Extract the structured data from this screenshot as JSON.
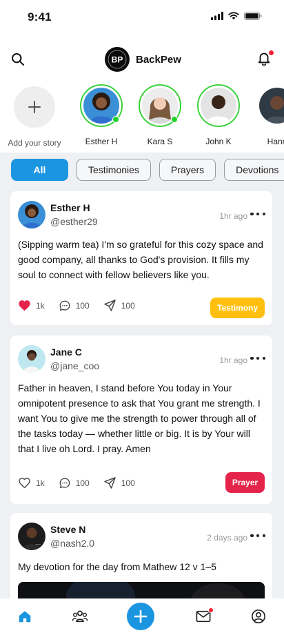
{
  "status_bar": {
    "time": "9:41"
  },
  "header": {
    "app_name": "BackPew",
    "logo_text": "BP"
  },
  "stories": {
    "add_label": "Add your story",
    "items": [
      {
        "name": "Esther H",
        "online": true
      },
      {
        "name": "Kara S",
        "online": true
      },
      {
        "name": "John K",
        "online": false
      },
      {
        "name": "Hann",
        "online": false
      }
    ]
  },
  "filters": {
    "items": [
      "All",
      "Testimonies",
      "Prayers",
      "Devotions"
    ],
    "active": "All"
  },
  "posts": [
    {
      "name": "Esther H",
      "handle": "@esther29",
      "time": "1hr ago",
      "text": "(Sipping warm tea) I'm so grateful for this cozy space and good company, all thanks to God's provision. It fills my soul to connect with fellow believers like you.",
      "likes": "1k",
      "liked": true,
      "comments": "100",
      "shares": "100",
      "tag": "Testimony",
      "tag_color": "#ffbf0f"
    },
    {
      "name": "Jane C",
      "handle": "@jane_coo",
      "time": "1hr ago",
      "text": "Father in heaven, I stand before You today in Your omnipotent presence to ask that You grant me strength. I want You to give me the strength to power through all of the tasks today — whether little or big. It is by Your will that I live oh Lord.  I pray. Amen",
      "likes": "1k",
      "liked": false,
      "comments": "100",
      "shares": "100",
      "tag": "Prayer",
      "tag_color": "#e5244b"
    },
    {
      "name": "Steve N",
      "handle": "@nash2.0",
      "time": "2 days ago",
      "text": "My devotion for the day from  Mathew 12 v 1–5"
    }
  ],
  "bottom_nav": {
    "items": [
      "home-icon",
      "community-icon",
      "add-post-icon",
      "mail-icon",
      "profile-icon"
    ],
    "active": "home-icon"
  },
  "colors": {
    "accent": "#1b95e0",
    "online": "#22d12a",
    "notification": "#ee2233",
    "like": "#e5244b",
    "testimony": "#ffbf0f",
    "prayer": "#e5244b"
  }
}
